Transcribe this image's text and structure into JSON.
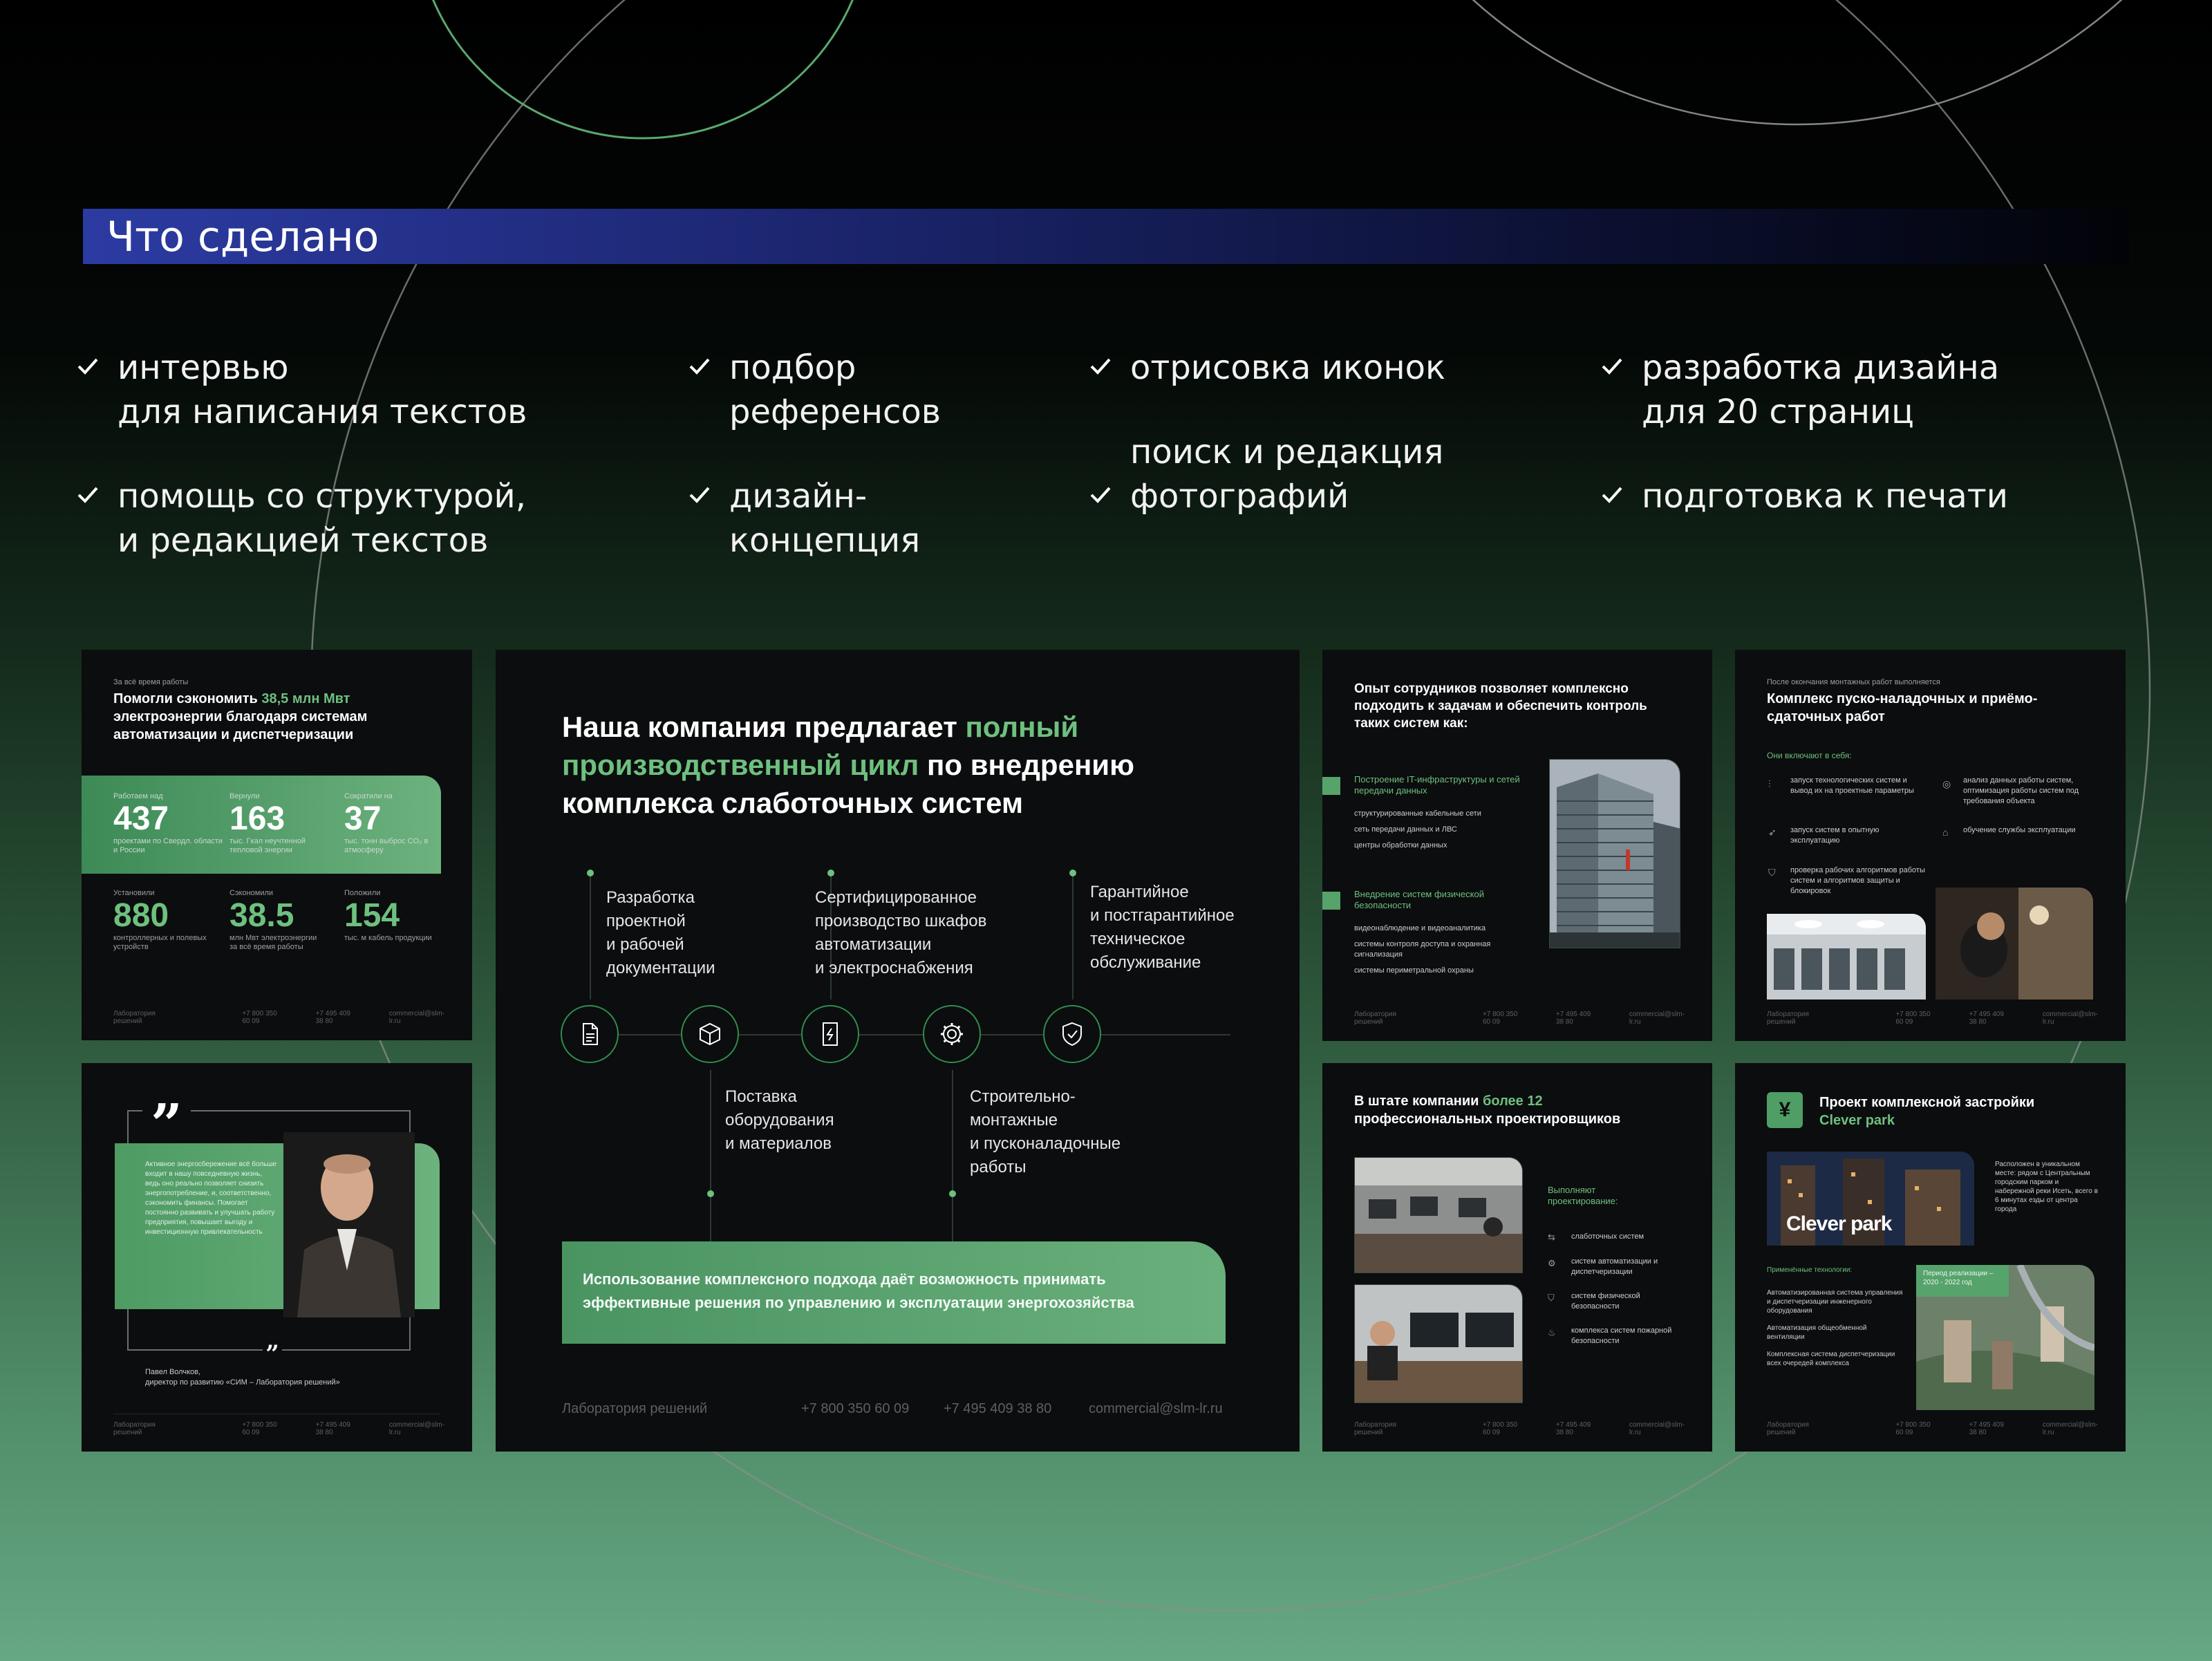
{
  "header": {
    "title": "Что сделано"
  },
  "tasks": [
    {
      "text": "интервью\nдля написания текстов"
    },
    {
      "text": "помощь со структурой,\nи редакцией текстов"
    },
    {
      "text": "подбор\nреференсов"
    },
    {
      "text": "дизайн-\nконцепция"
    },
    {
      "text": "отрисовка иконок"
    },
    {
      "text": "поиск и редакция\nфотографий"
    },
    {
      "text": "разработка дизайна\nдля 20 страниц"
    },
    {
      "text": "подготовка к печати"
    }
  ],
  "footer": {
    "brand": "Лаборатория решений",
    "phone1": "+7 800 350 60 09",
    "phone2": "+7 495 409 38 80",
    "email": "commercial@slm-lr.ru"
  },
  "slide1": {
    "pre": "За всё время работы",
    "title_a": "Помогли сэкономить ",
    "title_hl": "38,5 млн Мвт",
    "title_b": "электроэнергии благодаря системам автоматизации и диспетчеризации",
    "stats_top": [
      {
        "cap": "Работаем над",
        "num": "437",
        "lbl": "проектами по Свердл. области и России"
      },
      {
        "cap": "Вернули",
        "num": "163",
        "lbl": "тыс. Гкал неучтенной тепловой энергии"
      },
      {
        "cap": "Сократили на",
        "num": "37",
        "lbl": "тыс. тонн выброс CO₂ в атмосферу"
      }
    ],
    "stats_bottom": [
      {
        "cap": "Установили",
        "num": "880",
        "lbl": "контроллерных и полевых устройств"
      },
      {
        "cap": "Сэкономили",
        "num": "38.5",
        "lbl": "млн Мвт электроэнергии за всё время работы"
      },
      {
        "cap": "Положили",
        "num": "154",
        "lbl": "тыс. м кабель продукции"
      }
    ]
  },
  "slide2": {
    "quote": "Активное энергосбережение всё больше входит в нашу повседневную жизнь, ведь оно реально позволяет снизить энергопотребление, и, соответственно, сэкономить финансы. Помогает постоянно развивать и улучшать работу предприятия, повышает выгоду и инвестиционную привлекательность",
    "name": "Павел Волчков,",
    "role": "директор по развитию «СИМ – Лаборатория решений»"
  },
  "slide3": {
    "title_a": "Наша компания предлагает ",
    "title_hl": "полный производственный цикл",
    "title_b": " по внедрению комплекса слаботочных систем",
    "steps_top": [
      "Разработка\nпроектной\nи рабочей\nдокументации",
      "Сертифицированное\nпроизводство шкафов\nавтоматизации\nи электроснабжения",
      "Гарантийное\nи постгарантийное\nтехническое\nобслуживание"
    ],
    "steps_bottom": [
      "Поставка\nоборудования\nи материалов",
      "Строительно-\nмонтажные\nи пусконаладочные\nработы"
    ],
    "banner": "Использование комплексного подхода даёт возможность принимать эффективные решения по управлению и эксплуатации энергохозяйства",
    "icons": [
      "document-icon",
      "box-icon",
      "cabinet-icon",
      "gear-icon",
      "shield-check-icon"
    ]
  },
  "slide4": {
    "title": "Опыт сотрудников позволяет комплексно подходить к задачам и обеспечить контроль таких систем как:",
    "groups": [
      {
        "head": "Построение IT-инфраструктуры и сетей передачи данных",
        "items": [
          "структурированные кабельные сети",
          "сеть передачи данных и ЛВС",
          "центры обработки данных"
        ]
      },
      {
        "head": "Внедрение систем физической безопасности",
        "items": [
          "видеонаблюдение и видеоаналитика",
          "системы контроля доступа и охранная сигнализация",
          "системы периметральной охраны"
        ]
      }
    ]
  },
  "slide5": {
    "pre": "После окончания монтажных работ выполняется",
    "title": "Комплекс пуско-наладочных и приёмо-сдаточных работ",
    "sub": "Они включают в себя:",
    "left": [
      "запуск технологических систем и вывод их на проектные параметры",
      "запуск систем в опытную эксплуатацию",
      "проверка рабочих алгоритмов работы систем и алгоритмов защиты и блокировок"
    ],
    "right": [
      "анализ данных работы систем, оптимизация работы систем под требования объекта",
      "обучение службы эксплуатации"
    ]
  },
  "slide6": {
    "title_a": "В штате компании ",
    "title_hl": "более 12",
    "title_b": "профессиональных проектировщиков",
    "sub": "Выполняют проектирование:",
    "items": [
      "слаботочных систем",
      "систем автоматизации и диспетчеризации",
      "систем физической безопасности",
      "комплекса систем пожарной безопасности"
    ]
  },
  "slide7": {
    "title_a": "Проект комплексной застройки ",
    "title_hl": "Clever park",
    "logo_text": "Clever park",
    "desc": "Расположен в уникальном месте: рядом с Центральным городским парком и набережной реки Исеть, всего в 6 минутах езды от центра города",
    "tech_head": "Применённые технологии:",
    "tech": [
      "Автоматизированная система управления и диспетчеризации инженерного оборудования",
      "Автоматизация общеобменной вентиляции",
      "Комплексная система диспетчеризации всех очередей комплекса"
    ],
    "period": "Период реализации – 2020 - 2022 год"
  }
}
